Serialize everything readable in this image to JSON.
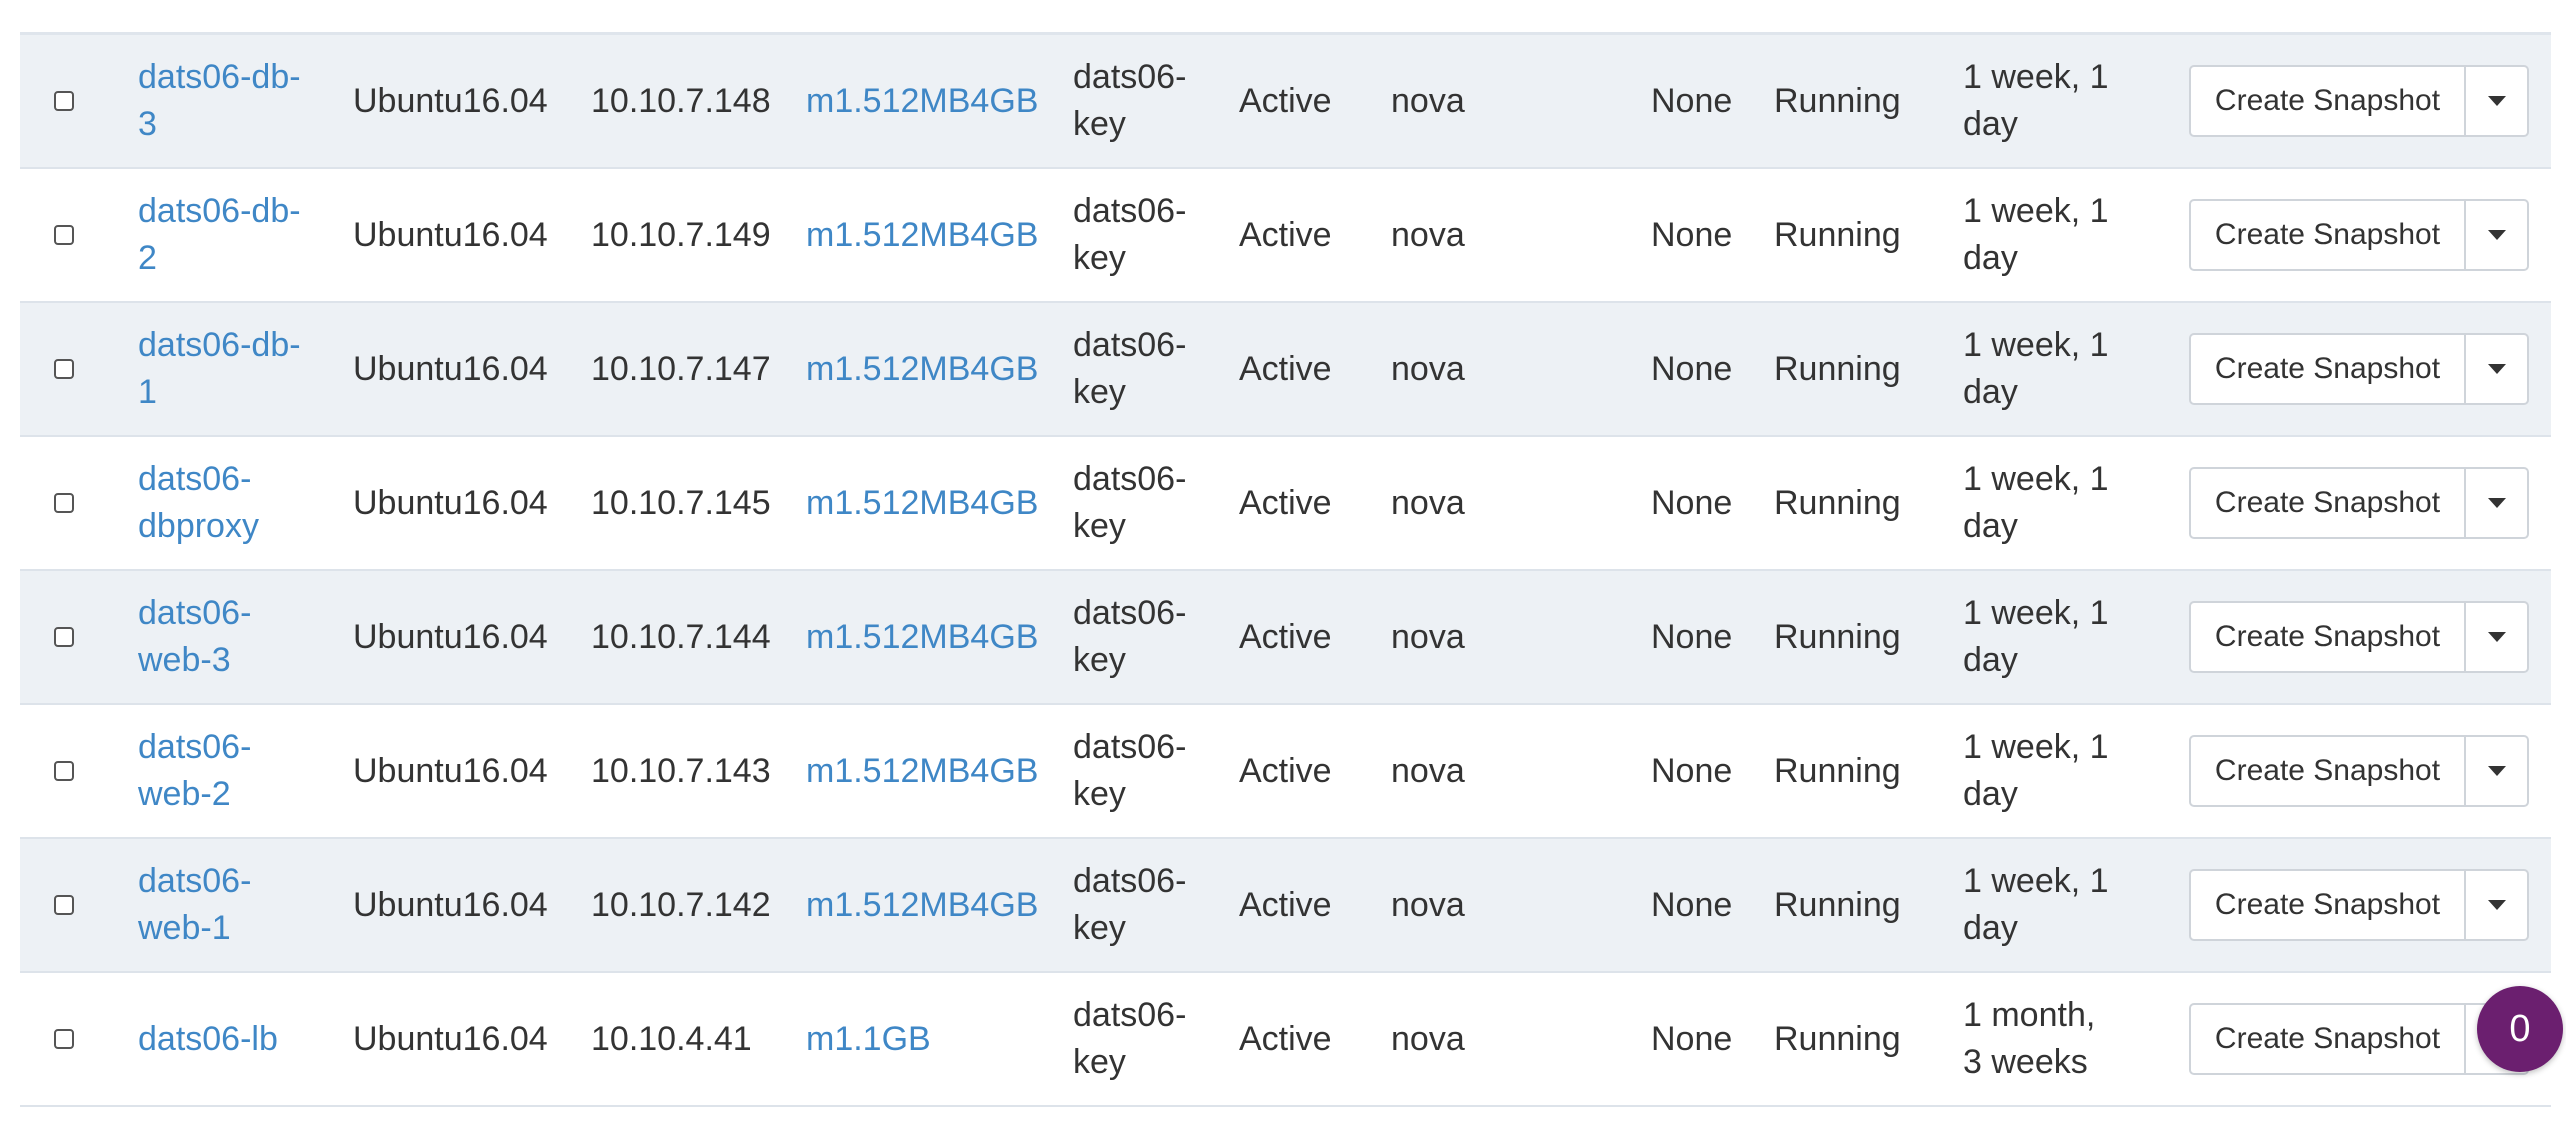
{
  "instances": [
    {
      "name": "dats06-db-3",
      "image": "Ubuntu16.04",
      "ip": "10.10.7.148",
      "flavor": "m1.512MB4GB",
      "key_pair": "dats06-key",
      "status": "Active",
      "availability_zone": "nova",
      "task": "None",
      "power_state": "Running",
      "age": "1 week, 1 day",
      "action_label": "Create Snapshot"
    },
    {
      "name": "dats06-db-2",
      "image": "Ubuntu16.04",
      "ip": "10.10.7.149",
      "flavor": "m1.512MB4GB",
      "key_pair": "dats06-key",
      "status": "Active",
      "availability_zone": "nova",
      "task": "None",
      "power_state": "Running",
      "age": "1 week, 1 day",
      "action_label": "Create Snapshot"
    },
    {
      "name": "dats06-db-1",
      "image": "Ubuntu16.04",
      "ip": "10.10.7.147",
      "flavor": "m1.512MB4GB",
      "key_pair": "dats06-key",
      "status": "Active",
      "availability_zone": "nova",
      "task": "None",
      "power_state": "Running",
      "age": "1 week, 1 day",
      "action_label": "Create Snapshot"
    },
    {
      "name": "dats06-dbproxy",
      "image": "Ubuntu16.04",
      "ip": "10.10.7.145",
      "flavor": "m1.512MB4GB",
      "key_pair": "dats06-key",
      "status": "Active",
      "availability_zone": "nova",
      "task": "None",
      "power_state": "Running",
      "age": "1 week, 1 day",
      "action_label": "Create Snapshot"
    },
    {
      "name": "dats06-web-3",
      "image": "Ubuntu16.04",
      "ip": "10.10.7.144",
      "flavor": "m1.512MB4GB",
      "key_pair": "dats06-key",
      "status": "Active",
      "availability_zone": "nova",
      "task": "None",
      "power_state": "Running",
      "age": "1 week, 1 day",
      "action_label": "Create Snapshot"
    },
    {
      "name": "dats06-web-2",
      "image": "Ubuntu16.04",
      "ip": "10.10.7.143",
      "flavor": "m1.512MB4GB",
      "key_pair": "dats06-key",
      "status": "Active",
      "availability_zone": "nova",
      "task": "None",
      "power_state": "Running",
      "age": "1 week, 1 day",
      "action_label": "Create Snapshot"
    },
    {
      "name": "dats06-web-1",
      "image": "Ubuntu16.04",
      "ip": "10.10.7.142",
      "flavor": "m1.512MB4GB",
      "key_pair": "dats06-key",
      "status": "Active",
      "availability_zone": "nova",
      "task": "None",
      "power_state": "Running",
      "age": "1 week, 1 day",
      "action_label": "Create Snapshot"
    },
    {
      "name": "dats06-lb",
      "image": "Ubuntu16.04",
      "ip": "10.10.4.41",
      "flavor": "m1.1GB",
      "key_pair": "dats06-key",
      "status": "Active",
      "availability_zone": "nova",
      "task": "None",
      "power_state": "Running",
      "age": "1 month, 3 weeks",
      "action_label": "Create Snapshot"
    }
  ],
  "notification_badge": {
    "count": "0",
    "color": "#6b1f6f"
  },
  "colors": {
    "link": "#3f87c6",
    "row_stripe": "#edf1f5"
  }
}
